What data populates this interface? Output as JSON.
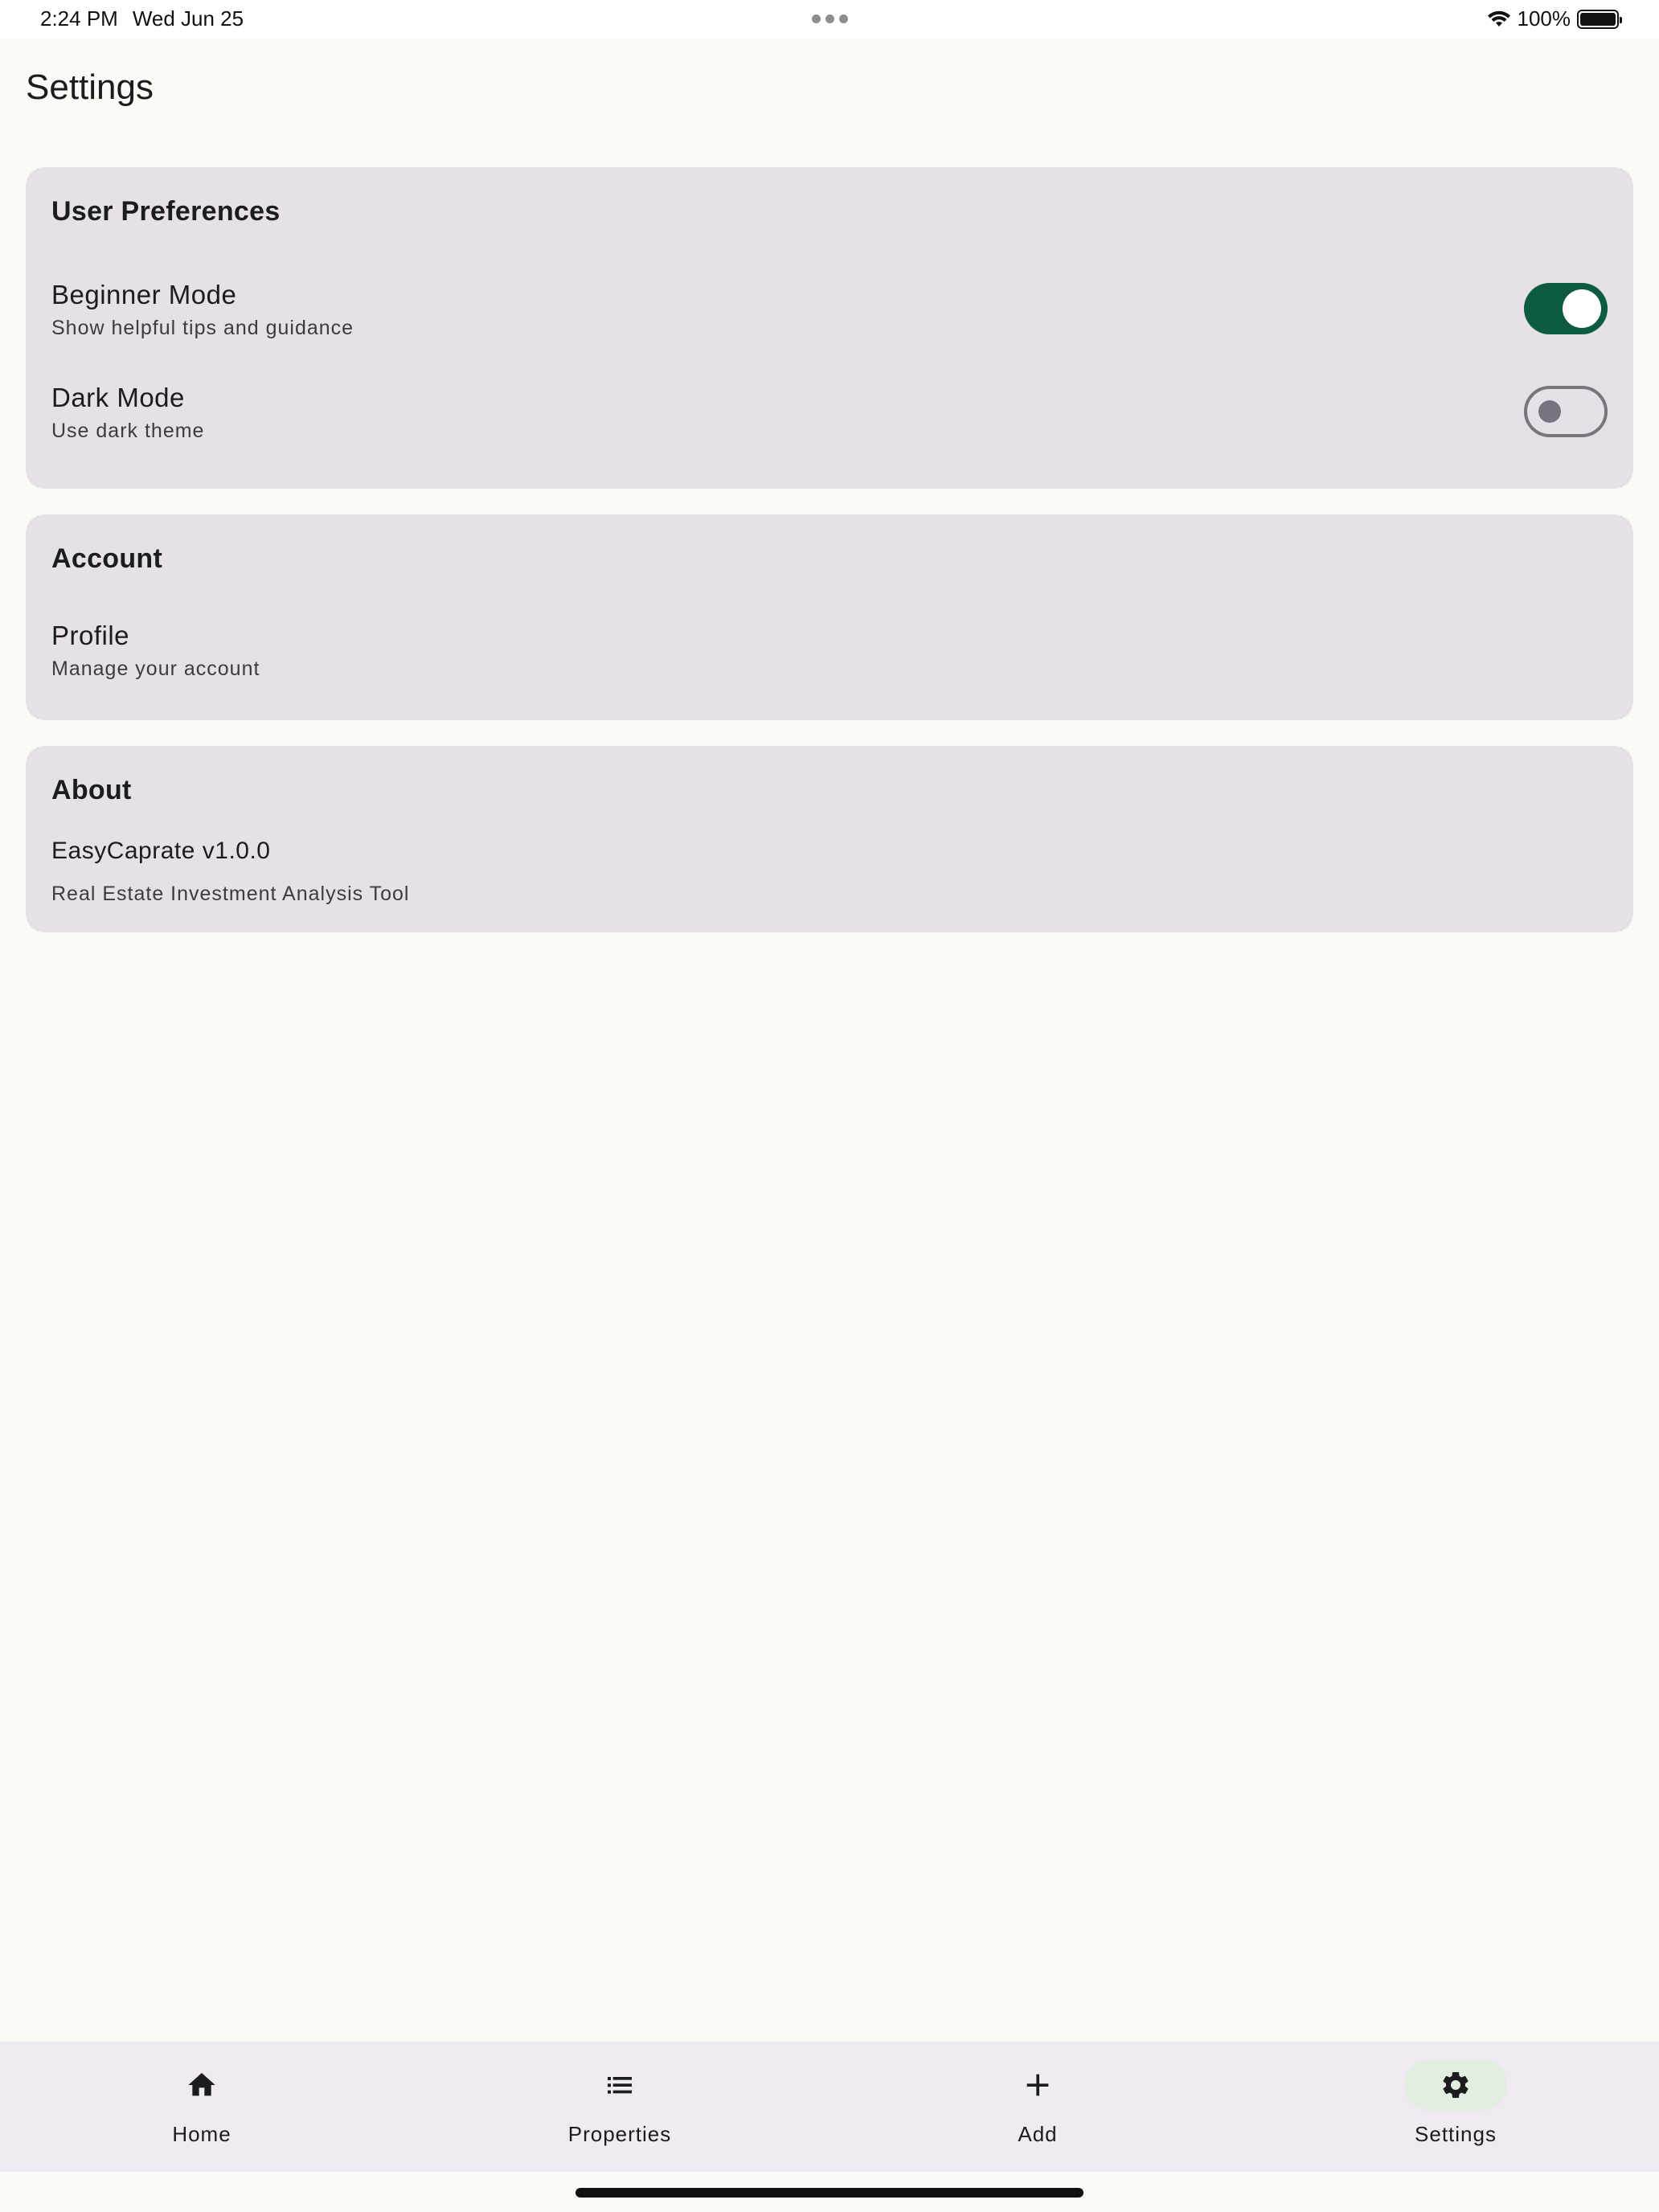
{
  "status_bar": {
    "time": "2:24 PM",
    "date": "Wed Jun 25",
    "battery": "100%"
  },
  "page": {
    "title": "Settings"
  },
  "sections": {
    "preferences": {
      "title": "User Preferences",
      "beginner": {
        "label": "Beginner Mode",
        "description": "Show helpful tips and guidance",
        "enabled": true
      },
      "dark": {
        "label": "Dark Mode",
        "description": "Use dark theme",
        "enabled": false
      }
    },
    "account": {
      "title": "Account",
      "profile": {
        "label": "Profile",
        "description": "Manage your account"
      }
    },
    "about": {
      "title": "About",
      "app_version": "EasyCaprate v1.0.0",
      "tagline": "Real Estate Investment Analysis Tool"
    }
  },
  "bottom_nav": {
    "items": [
      {
        "label": "Home",
        "icon": "home-icon"
      },
      {
        "label": "Properties",
        "icon": "list-icon"
      },
      {
        "label": "Add",
        "icon": "plus-icon"
      },
      {
        "label": "Settings",
        "icon": "gear-icon",
        "active": true
      }
    ]
  },
  "colors": {
    "accent": "#0d5c3f",
    "card_bg": "#e6e0e8",
    "page_bg": "#fafaf6",
    "nav_bg": "#f0eaf3",
    "nav_active_pill": "#e2eee0"
  }
}
